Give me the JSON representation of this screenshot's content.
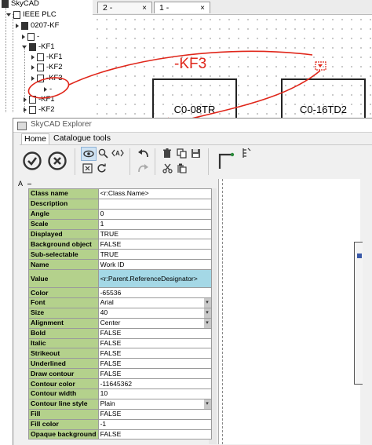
{
  "tree": {
    "root_label": "SkyCAD",
    "plc_label": "IEEE PLC",
    "nodes": [
      {
        "label": "0207-KF"
      },
      {
        "label": "-"
      },
      {
        "label": "-KF1"
      },
      {
        "label": "-KF1"
      },
      {
        "label": "-KF2"
      },
      {
        "label": "-KF3"
      },
      {
        "label": "-"
      },
      {
        "label": "-KF1"
      },
      {
        "label": "-KF2"
      }
    ]
  },
  "tabs": [
    {
      "label": "2 -",
      "close": "×"
    },
    {
      "label": "1 -",
      "close": "×"
    }
  ],
  "canvas": {
    "annotation_text": "-KF3",
    "boxes": [
      {
        "label": "C0-08TR"
      },
      {
        "label": "C0-16TD2"
      }
    ],
    "annotation_color": "#e0261a"
  },
  "explorer": {
    "title": "SkyCAD Explorer",
    "menu": [
      "Home",
      "Catalogue tools"
    ],
    "grid_header": "A",
    "properties": [
      {
        "name": "Class name",
        "value": "<r:Class.Name>"
      },
      {
        "name": "Description",
        "value": ""
      },
      {
        "name": "Angle",
        "value": "0"
      },
      {
        "name": "Scale",
        "value": "1"
      },
      {
        "name": "Displayed",
        "value": "TRUE"
      },
      {
        "name": "Background object",
        "value": "FALSE"
      },
      {
        "name": "Sub-selectable",
        "value": "TRUE"
      },
      {
        "name": "Name",
        "value": "Work ID"
      },
      {
        "name": "Value",
        "value": "<r:Parent.ReferenceDesignator>"
      },
      {
        "name": "Color",
        "value": "-65536"
      },
      {
        "name": "Font",
        "value": "Arial"
      },
      {
        "name": "Size",
        "value": "40"
      },
      {
        "name": "Alignment",
        "value": "Center"
      },
      {
        "name": "Bold",
        "value": "FALSE"
      },
      {
        "name": "Italic",
        "value": "FALSE"
      },
      {
        "name": "Strikeout",
        "value": "FALSE"
      },
      {
        "name": "Underlined",
        "value": "FALSE"
      },
      {
        "name": "Draw contour",
        "value": "FALSE"
      },
      {
        "name": "Contour color",
        "value": "-11645362"
      },
      {
        "name": "Contour width",
        "value": "10"
      },
      {
        "name": "Contour line style",
        "value": "Plain"
      },
      {
        "name": "Fill",
        "value": "FALSE"
      },
      {
        "name": "Fill color",
        "value": "-1"
      },
      {
        "name": "Opaque background",
        "value": "FALSE"
      }
    ],
    "colors": {
      "key_bg": "#b4d18c",
      "highlight_bg": "#a4d8e6"
    }
  }
}
